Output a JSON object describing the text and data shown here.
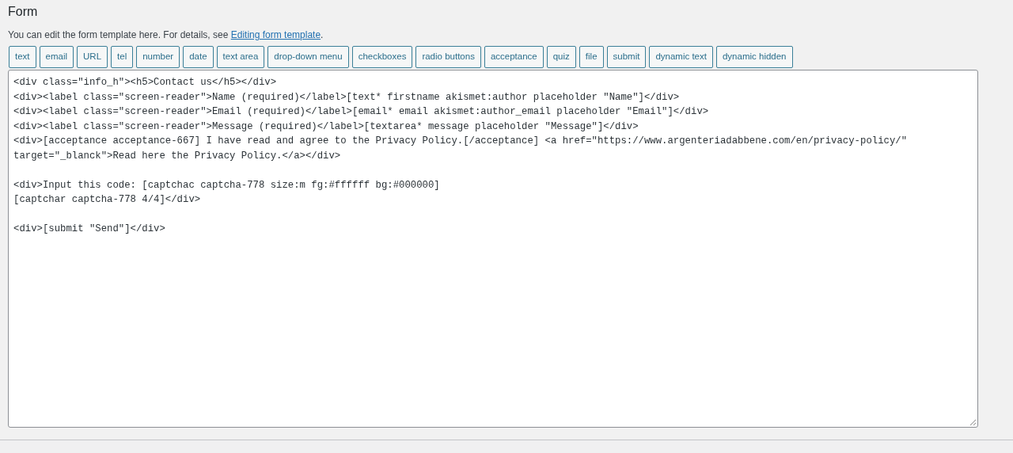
{
  "section": {
    "title": "Form"
  },
  "intro": {
    "text": "You can edit the form template here. For details, see ",
    "link": "Editing form template",
    "suffix": "."
  },
  "tag_buttons": [
    "text",
    "email",
    "URL",
    "tel",
    "number",
    "date",
    "text area",
    "drop-down menu",
    "checkboxes",
    "radio buttons",
    "acceptance",
    "quiz",
    "file",
    "submit",
    "dynamic text",
    "dynamic hidden"
  ],
  "editor": {
    "value": "<div class=\"info_h\"><h5>Contact us</h5></div>\n<div><label class=\"screen-reader\">Name (required)</label>[text* firstname akismet:author placeholder \"Name\"]</div>\n<div><label class=\"screen-reader\">Email (required)</label>[email* email akismet:author_email placeholder \"Email\"]</div>\n<div><label class=\"screen-reader\">Message (required)</label>[textarea* message placeholder \"Message\"]</div>\n<div>[acceptance acceptance-667] I have read and agree to the Privacy Policy.[/acceptance] <a href=\"https://www.argenteriadabbene.com/en/privacy-policy/\" target=\"_blanck\">Read here the Privacy Policy.</a></div>\n\n<div>Input this code: [captchac captcha-778 size:m fg:#ffffff bg:#000000]\n[captchar captcha-778 4/4]</div>\n\n<div>[submit \"Send\"]</div>"
  }
}
